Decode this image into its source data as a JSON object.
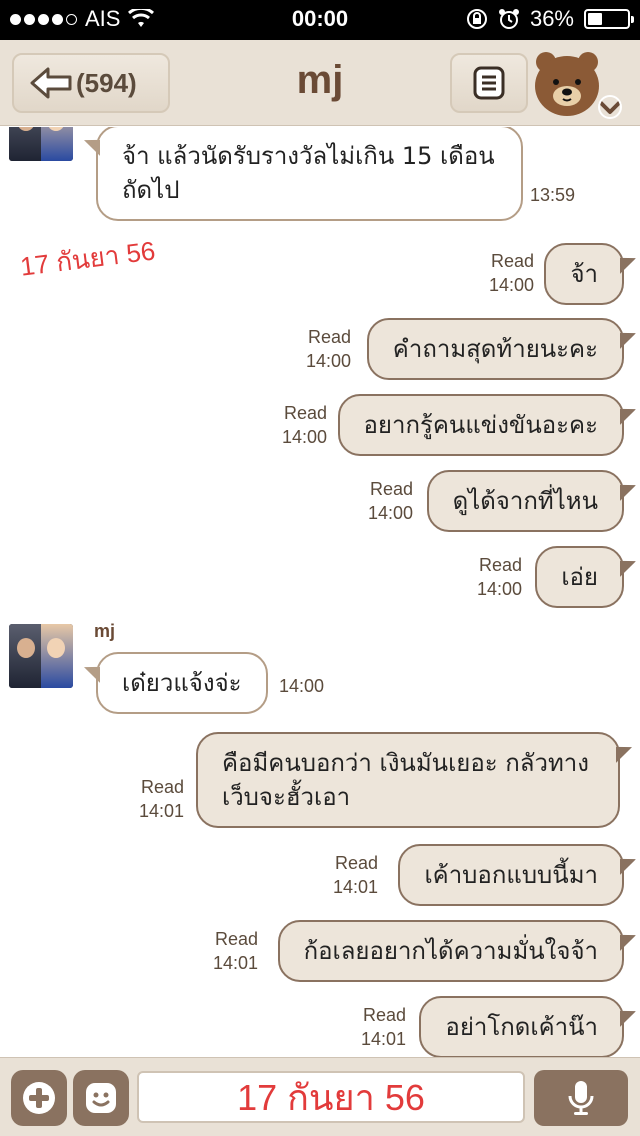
{
  "status_bar": {
    "carrier": "AIS",
    "time": "00:00",
    "battery": "36%",
    "battery_level": 0.36
  },
  "header": {
    "back_count": "(594)",
    "title": "mj"
  },
  "annotation": "17 กันยา 56",
  "messages": [
    {
      "side": "left",
      "text_lines": [
        "จ้า แล้วนัดรับรางวัลไม่เกิน 15 เดือน",
        "ถัดไป"
      ],
      "time": "13:59"
    },
    {
      "side": "right",
      "text": "จ้า",
      "read": "Read",
      "time": "14:00"
    },
    {
      "side": "right",
      "text": "คำถามสุดท้ายนะคะ",
      "read": "Read",
      "time": "14:00"
    },
    {
      "side": "right",
      "text": "อยากรู้คนแข่งขันอะคะ",
      "read": "Read",
      "time": "14:00"
    },
    {
      "side": "right",
      "text": "ดูได้จากที่ไหน",
      "read": "Read",
      "time": "14:00"
    },
    {
      "side": "right",
      "text": "เอ่ย",
      "read": "Read",
      "time": "14:00"
    },
    {
      "side": "left",
      "sender": "mj",
      "text": "เด๋ยวแจ้งจ่ะ",
      "time": "14:00"
    },
    {
      "side": "right",
      "text_lines": [
        "คือมีคนบอกว่า เงินมันเยอะ กลัวทาง",
        "เว็บจะฮั้วเอา"
      ],
      "read": "Read",
      "time": "14:01"
    },
    {
      "side": "right",
      "text": "เค้าบอกแบบนี้มา",
      "read": "Read",
      "time": "14:01"
    },
    {
      "side": "right",
      "text": "ก้อเลยอยากได้ความมั่นใจจ้า",
      "read": "Read",
      "time": "14:01"
    },
    {
      "side": "right",
      "text": "อย่าโกดเค้าน๊า",
      "read": "Read",
      "time": "14:01"
    }
  ],
  "input": {
    "value": "17 กันยา 56"
  },
  "icons": {
    "back": "back-arrow-icon",
    "menu": "menu-icon",
    "sticker": "bear-sticker-icon",
    "add": "plus-icon",
    "emoji": "smiley-icon",
    "mic": "microphone-icon"
  }
}
